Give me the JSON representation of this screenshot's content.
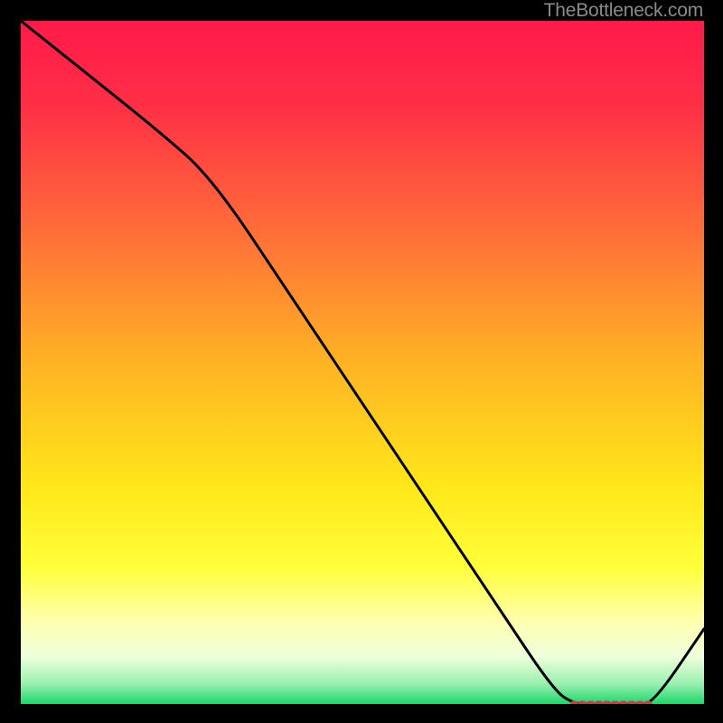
{
  "watermark": "TheBottleneck.com",
  "chart_data": {
    "type": "line",
    "title": "",
    "xlabel": "",
    "ylabel": "",
    "xlim": [
      0,
      100
    ],
    "ylim": [
      0,
      100
    ],
    "gradient_stops": [
      {
        "offset": 0.0,
        "color": "#ff1a4a"
      },
      {
        "offset": 0.12,
        "color": "#ff2e46"
      },
      {
        "offset": 0.3,
        "color": "#ff6a3a"
      },
      {
        "offset": 0.5,
        "color": "#ffb324"
      },
      {
        "offset": 0.68,
        "color": "#ffe71a"
      },
      {
        "offset": 0.8,
        "color": "#ffff3a"
      },
      {
        "offset": 0.88,
        "color": "#ffffb0"
      },
      {
        "offset": 0.93,
        "color": "#f0ffdc"
      },
      {
        "offset": 0.97,
        "color": "#9cf0b0"
      },
      {
        "offset": 1.0,
        "color": "#1fd66a"
      }
    ],
    "series": [
      {
        "name": "curve",
        "x": [
          0,
          10,
          20,
          28,
          40,
          50,
          60,
          70,
          78,
          81,
          84,
          87,
          90,
          92.5,
          100
        ],
        "y": [
          100,
          92,
          84,
          77,
          59,
          44,
          29,
          14,
          2,
          0,
          0,
          0,
          0,
          0,
          11
        ]
      }
    ],
    "markers": {
      "name": "bottom-cluster",
      "x": [
        81.0,
        82.2,
        83.4,
        84.6,
        85.8,
        87.0,
        88.2,
        89.4,
        90.6,
        91.8
      ],
      "y": [
        0,
        0,
        0,
        0,
        0,
        0,
        0,
        0,
        0,
        0
      ]
    }
  }
}
